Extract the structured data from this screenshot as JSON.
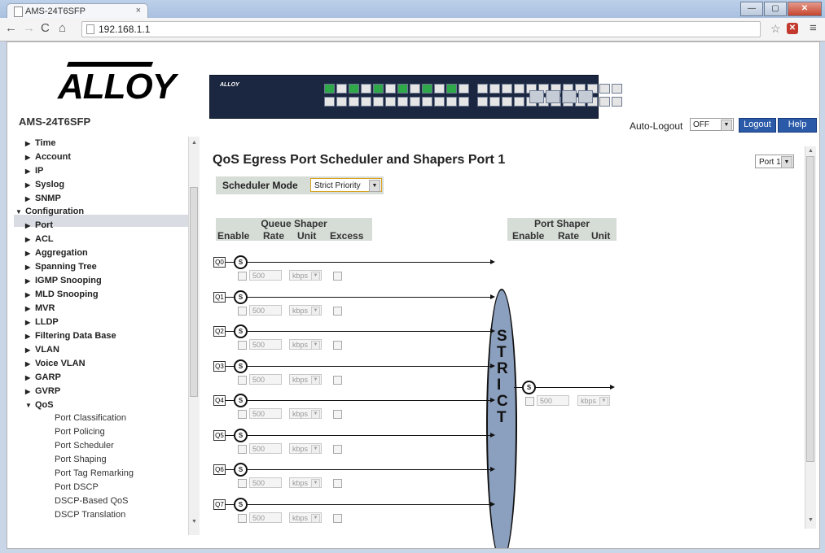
{
  "browser": {
    "tab_title": "AMS-24T6SFP",
    "tab_close": "×",
    "url": "192.168.1.1",
    "window_buttons": [
      "—",
      "▢",
      "✕"
    ]
  },
  "header": {
    "logo": "ALLOY",
    "model": "AMS-24T6SFP",
    "auto_logout_label": "Auto-Logout",
    "auto_logout_value": "OFF",
    "logout_label": "Logout",
    "help_label": "Help"
  },
  "sidebar": {
    "items": [
      {
        "label": "Time",
        "arrow": "▶"
      },
      {
        "label": "Account",
        "arrow": "▶"
      },
      {
        "label": "IP",
        "arrow": "▶"
      },
      {
        "label": "Syslog",
        "arrow": "▶"
      },
      {
        "label": "SNMP",
        "arrow": "▶"
      },
      {
        "label": "Configuration",
        "arrow": "▼"
      },
      {
        "label": "Port",
        "arrow": "▶"
      },
      {
        "label": "ACL",
        "arrow": "▶"
      },
      {
        "label": "Aggregation",
        "arrow": "▶"
      },
      {
        "label": "Spanning Tree",
        "arrow": "▶"
      },
      {
        "label": "IGMP Snooping",
        "arrow": "▶"
      },
      {
        "label": "MLD Snooping",
        "arrow": "▶"
      },
      {
        "label": "MVR",
        "arrow": "▶"
      },
      {
        "label": "LLDP",
        "arrow": "▶"
      },
      {
        "label": "Filtering Data Base",
        "arrow": "▶"
      },
      {
        "label": "VLAN",
        "arrow": "▶"
      },
      {
        "label": "Voice VLAN",
        "arrow": "▶"
      },
      {
        "label": "GARP",
        "arrow": "▶"
      },
      {
        "label": "GVRP",
        "arrow": "▶"
      },
      {
        "label": "QoS",
        "arrow": "▼"
      }
    ],
    "qos_subitems": [
      "Port Classification",
      "Port Policing",
      "Port Scheduler",
      "Port Shaping",
      "Port Tag Remarking",
      "Port DSCP",
      "DSCP-Based QoS",
      "DSCP Translation"
    ]
  },
  "main": {
    "title": "QoS Egress Port Scheduler and Shapers  Port 1",
    "port_select": "Port 1",
    "scheduler_mode_label": "Scheduler Mode",
    "scheduler_mode_value": "Strict Priority",
    "queue_shaper": {
      "title": "Queue Shaper",
      "columns": [
        "Enable",
        "Rate",
        "Unit",
        "Excess"
      ]
    },
    "port_shaper": {
      "title": "Port Shaper",
      "columns": [
        "Enable",
        "Rate",
        "Unit"
      ],
      "rate": "500",
      "unit": "kbps"
    },
    "scheduler_symbol": "S",
    "strict_letters": [
      "S",
      "T",
      "R",
      "I",
      "C",
      "T"
    ],
    "queues": [
      {
        "id": "Q0",
        "rate": "500",
        "unit": "kbps"
      },
      {
        "id": "Q1",
        "rate": "500",
        "unit": "kbps"
      },
      {
        "id": "Q2",
        "rate": "500",
        "unit": "kbps"
      },
      {
        "id": "Q3",
        "rate": "500",
        "unit": "kbps"
      },
      {
        "id": "Q4",
        "rate": "500",
        "unit": "kbps"
      },
      {
        "id": "Q5",
        "rate": "500",
        "unit": "kbps"
      },
      {
        "id": "Q6",
        "rate": "500",
        "unit": "kbps"
      },
      {
        "id": "Q7",
        "rate": "500",
        "unit": "kbps"
      }
    ]
  }
}
